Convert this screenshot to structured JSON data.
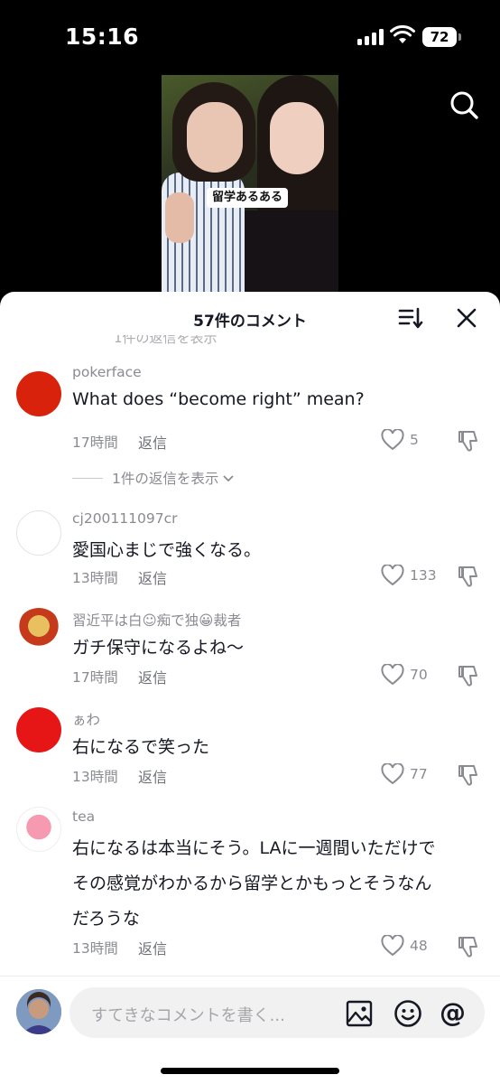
{
  "status_bar": {
    "time": "15:16",
    "battery": "72"
  },
  "video": {
    "caption": "留学あるある"
  },
  "panel": {
    "title": "57件のコメント",
    "faded_reply": "1件の返信を表示"
  },
  "comments": [
    {
      "username": "pokerface",
      "text": "What does “become right” mean?",
      "time": "17時間",
      "reply": "返信",
      "likes": "5",
      "more_replies": "1件の返信を表示"
    },
    {
      "username": "cj200111097cr",
      "text": "愛国心まじで強くなる。",
      "time": "13時間",
      "reply": "返信",
      "likes": "133"
    },
    {
      "username": "習近平は白☺痴で独😀裁者",
      "text": "ガチ保守になるよね〜",
      "time": "17時間",
      "reply": "返信",
      "likes": "70"
    },
    {
      "username": "ぁわ",
      "text": "右になるで笑った",
      "time": "13時間",
      "reply": "返信",
      "likes": "77"
    },
    {
      "username": "tea",
      "text_lines": [
        "右になるは本当にそう。LAに一週間いただけで",
        "その感覚がわかるから留学とかもっとそうなん",
        "だろうな"
      ],
      "time": "13時間",
      "reply": "返信",
      "likes": "48"
    }
  ],
  "input": {
    "placeholder": "すてきなコメントを書く..."
  },
  "colors": {
    "panel_bg": "#ffffff",
    "text": "#161823",
    "secondary": "#8a8b91",
    "avatar_red": "#e0220b"
  },
  "icons": [
    "search-icon",
    "sort-icon",
    "close-icon",
    "heart-icon",
    "dislike-icon",
    "chevron-down-icon",
    "image-icon",
    "emoji-icon",
    "at-icon"
  ]
}
